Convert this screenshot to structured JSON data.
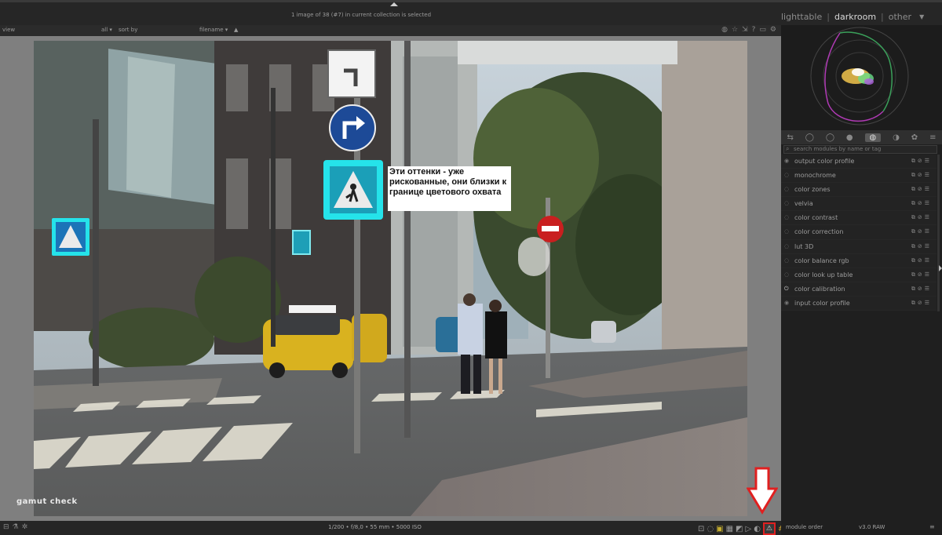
{
  "header": {
    "selection_info": "1 image of 38 (#7) in current collection is selected",
    "views": {
      "lighttable": "lighttable",
      "darkroom": "darkroom",
      "other": "other",
      "separator": "|"
    }
  },
  "filterbar": {
    "view": "view",
    "all": "all ▾",
    "sort_by": "sort by",
    "filename": "filename ▾",
    "sort_dir": "▲"
  },
  "photo": {
    "overlay_label": "gamut check",
    "annotation": "Эти оттенки - уже рискованные, они близки к границе цветового охвата"
  },
  "bottombar": {
    "exif": "1/200 • f/8,0 • 55 mm • 5000 ISO"
  },
  "rightpanel": {
    "search_placeholder": "search modules by name or tag",
    "modules": [
      {
        "label": "output color profile",
        "power": "◉"
      },
      {
        "label": "monochrome",
        "power": "◌"
      },
      {
        "label": "color zones",
        "power": "◌"
      },
      {
        "label": "velvia",
        "power": "◌"
      },
      {
        "label": "color contrast",
        "power": "◌"
      },
      {
        "label": "color correction",
        "power": "◌"
      },
      {
        "label": "lut 3D",
        "power": "◌"
      },
      {
        "label": "color balance rgb",
        "power": "◌"
      },
      {
        "label": "color look up table",
        "power": "◌"
      },
      {
        "label": "color calibration",
        "power": "⏻"
      },
      {
        "label": "input color profile",
        "power": "◉"
      }
    ],
    "module_order": "module order",
    "version": "v3.0 RAW"
  },
  "colors": {
    "highlight_arrow": "#e02020",
    "gamut_cyan": "#25e3ea"
  }
}
